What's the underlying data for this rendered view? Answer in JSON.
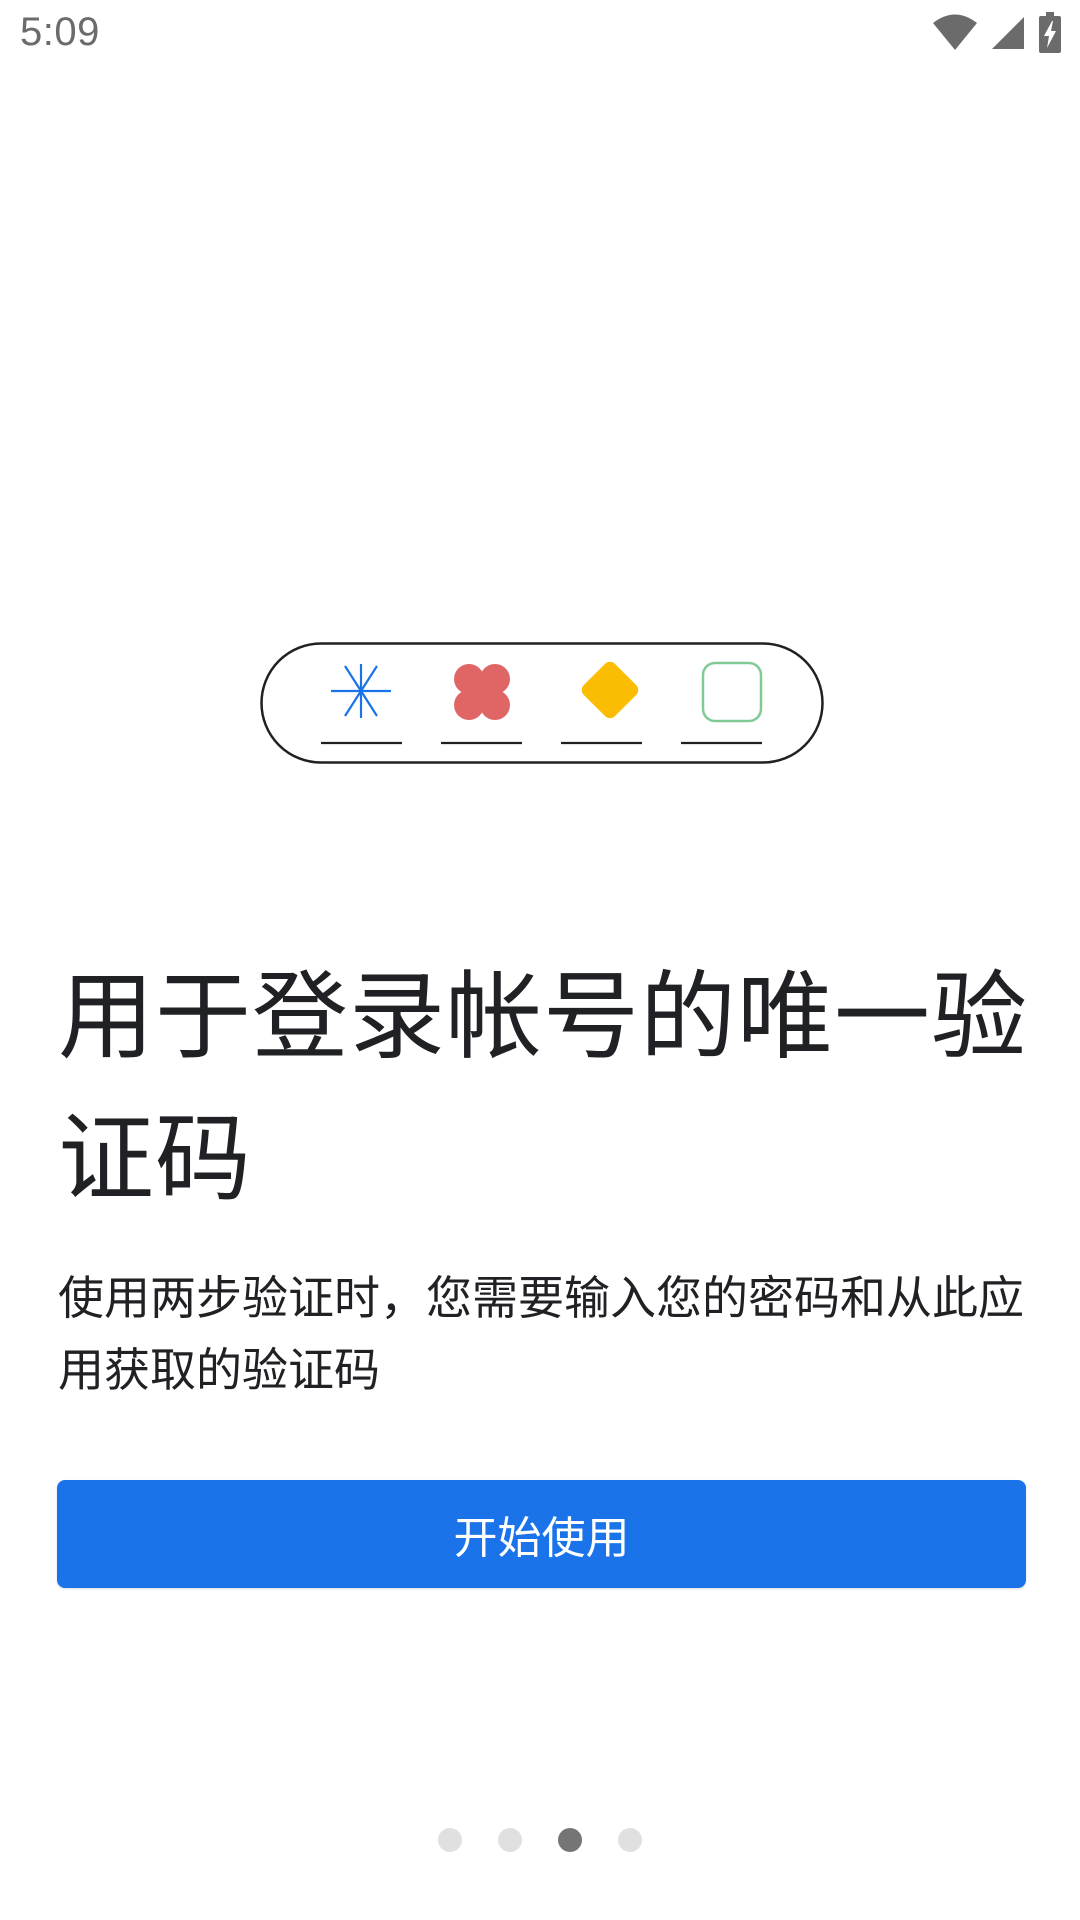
{
  "status_bar": {
    "time": "5:09",
    "icons": [
      "wifi-icon",
      "cellular-signal-icon",
      "battery-charging-icon"
    ]
  },
  "illustration": {
    "placeholder_symbols": [
      "asterisk",
      "flower",
      "diamond",
      "rounded-square"
    ],
    "colors": {
      "asterisk": "#1a73e8",
      "flower": "#e06666",
      "diamond": "#fbbc04",
      "square": "#81c995",
      "outline": "#202124"
    }
  },
  "title": "用于登录帐号的唯一验证码",
  "description": "使用两步验证时，您需要输入您的密码和从此应用获取的验证码",
  "button": {
    "label": "开始使用"
  },
  "pagination": {
    "total": 4,
    "current": 3
  },
  "colors": {
    "accent": "#1a73e8",
    "text": "#202124",
    "dot_active": "#757575",
    "dot_inactive": "#e0e0e0"
  }
}
